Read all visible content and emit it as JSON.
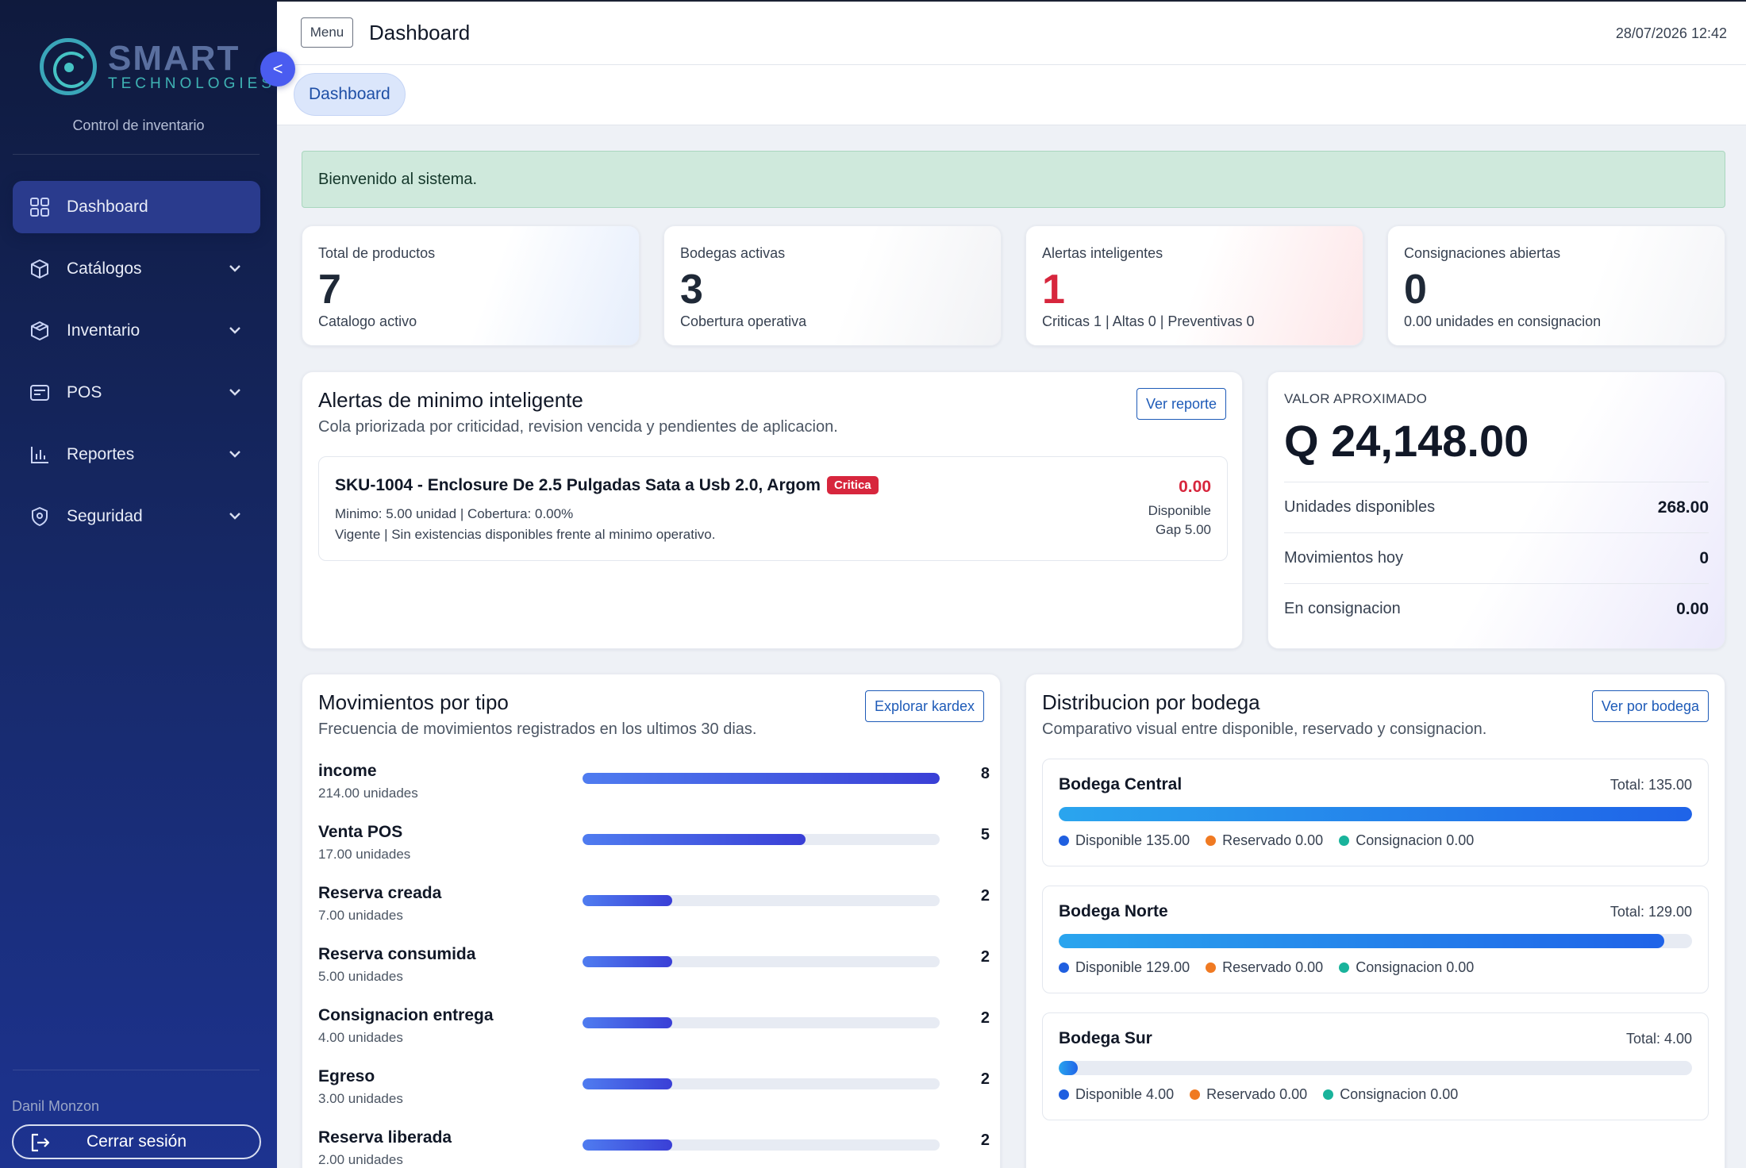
{
  "sidebar": {
    "logo_line1": "SMART",
    "logo_line2": "TECHNOLOGIES",
    "subtitle": "Control de inventario",
    "items": [
      {
        "label": "Dashboard",
        "icon": "grid-icon",
        "active": true
      },
      {
        "label": "Catálogos",
        "icon": "box-icon"
      },
      {
        "label": "Inventario",
        "icon": "package-icon"
      },
      {
        "label": "POS",
        "icon": "register-icon"
      },
      {
        "label": "Reportes",
        "icon": "bar-chart-icon"
      },
      {
        "label": "Seguridad",
        "icon": "shield-icon"
      }
    ],
    "user": "Danil Monzon",
    "logout_label": "Cerrar sesión",
    "collapse_label": "<"
  },
  "topbar": {
    "menu_label": "Menu",
    "title": "Dashboard",
    "datetime": "28/07/2026 12:42"
  },
  "tabs": [
    {
      "label": "Dashboard"
    }
  ],
  "welcome": "Bienvenido al sistema.",
  "stats": [
    {
      "label": "Total de productos",
      "value": "7",
      "sub": "Catalogo activo"
    },
    {
      "label": "Bodegas activas",
      "value": "3",
      "sub": "Cobertura operativa"
    },
    {
      "label": "Alertas inteligentes",
      "value": "1",
      "sub": "Criticas 1 | Altas 0 | Preventivas 0"
    },
    {
      "label": "Consignaciones abiertas",
      "value": "0",
      "sub": "0.00 unidades en consignacion"
    }
  ],
  "alerts": {
    "title": "Alertas de minimo inteligente",
    "subtitle": "Cola priorizada por criticidad, revision vencida y pendientes de aplicacion.",
    "button": "Ver reporte",
    "item": {
      "title": "SKU-1004 - Enclosure De 2.5 Pulgadas Sata a Usb 2.0, Argom",
      "badge": "Critica",
      "line1": "Minimo: 5.00 unidad | Cobertura: 0.00%",
      "line2": "Vigente | Sin existencias disponibles frente al minimo operativo.",
      "value": "0.00",
      "value_label": "Disponible",
      "gap": "Gap 5.00"
    }
  },
  "value_card": {
    "caption": "VALOR APROXIMADO",
    "amount": "Q 24,148.00",
    "rows": [
      {
        "label": "Unidades disponibles",
        "value": "268.00"
      },
      {
        "label": "Movimientos hoy",
        "value": "0"
      },
      {
        "label": "En consignacion",
        "value": "0.00"
      }
    ]
  },
  "movements": {
    "title": "Movimientos por tipo",
    "subtitle": "Frecuencia de movimientos registrados en los ultimos 30 dias.",
    "button": "Explorar kardex",
    "max": 8,
    "items": [
      {
        "name": "income",
        "units": "214.00 unidades",
        "count": 8
      },
      {
        "name": "Venta POS",
        "units": "17.00 unidades",
        "count": 5
      },
      {
        "name": "Reserva creada",
        "units": "7.00 unidades",
        "count": 2
      },
      {
        "name": "Reserva consumida",
        "units": "5.00 unidades",
        "count": 2
      },
      {
        "name": "Consignacion entrega",
        "units": "4.00 unidades",
        "count": 2
      },
      {
        "name": "Egreso",
        "units": "3.00 unidades",
        "count": 2
      },
      {
        "name": "Reserva liberada",
        "units": "2.00 unidades",
        "count": 2
      }
    ]
  },
  "distribution": {
    "title": "Distribucion por bodega",
    "subtitle": "Comparativo visual entre disponible, reservado y consignacion.",
    "button": "Ver por bodega",
    "max_total": 135,
    "colors": {
      "disponible": "#1f5fe0",
      "reservado": "#f07a22",
      "consignacion": "#19b39b"
    },
    "items": [
      {
        "name": "Bodega Central",
        "total": "Total: 135.00",
        "total_value": 135,
        "disponible": "Disponible 135.00",
        "reservado": "Reservado 0.00",
        "consignacion": "Consignacion 0.00"
      },
      {
        "name": "Bodega Norte",
        "total": "Total: 129.00",
        "total_value": 129,
        "disponible": "Disponible 129.00",
        "reservado": "Reservado 0.00",
        "consignacion": "Consignacion 0.00"
      },
      {
        "name": "Bodega Sur",
        "total": "Total: 4.00",
        "total_value": 4,
        "disponible": "Disponible 4.00",
        "reservado": "Reservado 0.00",
        "consignacion": "Consignacion 0.00"
      }
    ]
  }
}
